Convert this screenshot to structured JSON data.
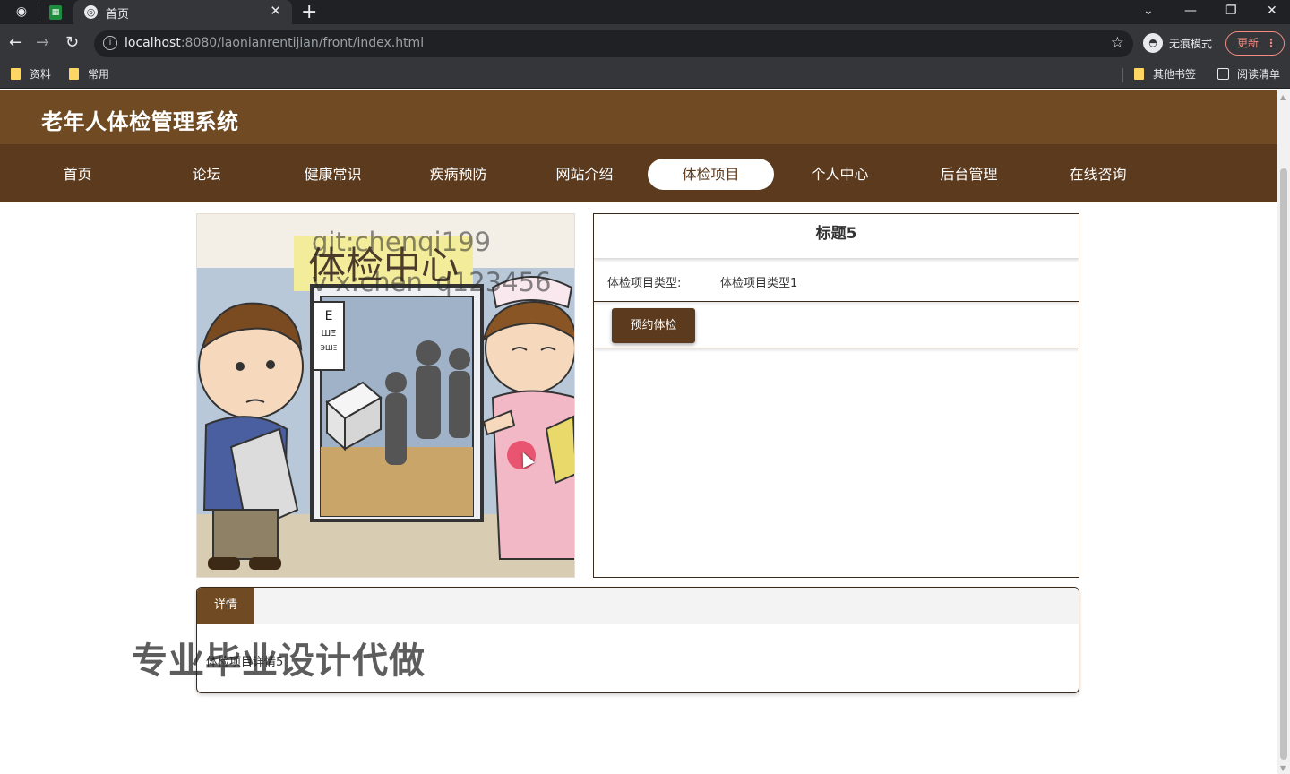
{
  "browser": {
    "tab_title": "首页",
    "url_host": "localhost",
    "url_rest": ":8080/laonianrentijian/front/index.html",
    "incognito_label": "无痕模式",
    "update_label": "更新",
    "bookmarks": [
      "资料",
      "常用"
    ],
    "bookmarks_right": [
      "其他书签",
      "阅读清单"
    ]
  },
  "site": {
    "title": "老年人体检管理系统",
    "nav": [
      "首页",
      "论坛",
      "健康常识",
      "疾病预防",
      "网站介绍",
      "体检项目",
      "个人中心",
      "后台管理",
      "在线咨询"
    ],
    "active_nav": "体检项目"
  },
  "detail": {
    "title": "标题5",
    "type_label": "体检项目类型:",
    "type_value": "体检项目类型1",
    "book_button": "预约体检",
    "image_sign": "体检中心",
    "tab_label": "详情",
    "content": "体检项目详情5"
  },
  "overlay": {
    "watermark_line1": "git:chenqi199",
    "watermark_line2": "v x:chen_q123456",
    "banner": "专业毕业设计代做"
  },
  "colors": {
    "header_brown": "#6f4a22",
    "nav_brown": "#5b3a1e",
    "button_brown": "#5b3a1e"
  }
}
